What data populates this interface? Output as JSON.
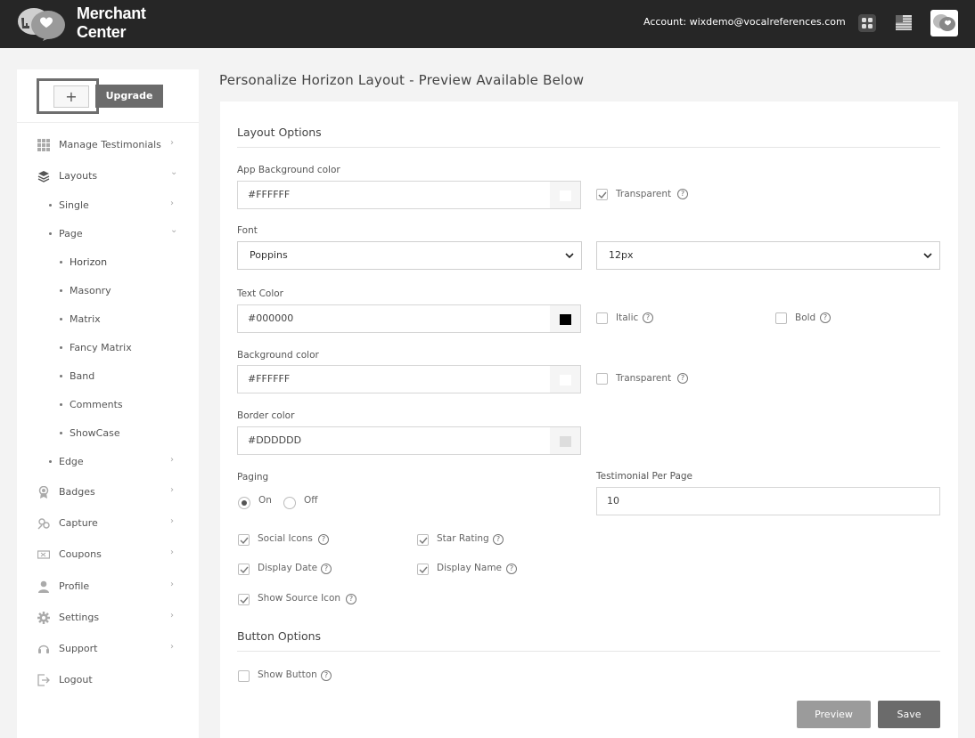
{
  "header": {
    "brand_line1": "Merchant",
    "brand_line2": "Center",
    "account": "Account: wixdemo@vocalreferences.com"
  },
  "sidebar": {
    "plus_label": "+",
    "upgrade_label": "Upgrade",
    "items": [
      {
        "label": "Manage Testimonials",
        "icon": "grid-icon"
      },
      {
        "label": "Layouts",
        "icon": "layers-icon"
      },
      {
        "label": "Single"
      },
      {
        "label": "Page"
      },
      {
        "label": "Horizon"
      },
      {
        "label": "Masonry"
      },
      {
        "label": "Matrix"
      },
      {
        "label": "Fancy Matrix"
      },
      {
        "label": "Band"
      },
      {
        "label": "Comments"
      },
      {
        "label": "ShowCase"
      },
      {
        "label": "Edge"
      },
      {
        "label": "Badges",
        "icon": "badge-icon"
      },
      {
        "label": "Capture",
        "icon": "capture-icon"
      },
      {
        "label": "Coupons",
        "icon": "coupon-icon"
      },
      {
        "label": "Profile",
        "icon": "user-icon"
      },
      {
        "label": "Settings",
        "icon": "gear-icon"
      },
      {
        "label": "Support",
        "icon": "support-icon"
      },
      {
        "label": "Logout",
        "icon": "logout-icon"
      }
    ]
  },
  "main": {
    "title": "Personalize Horizon Layout - Preview Available Below",
    "layout_options": "Layout Options",
    "app_bg_label": "App Background color",
    "app_bg_value": "#FFFFFF",
    "transparent_label": "Transparent",
    "font_label": "Font",
    "font_value": "Poppins",
    "font_size_value": "12px",
    "text_color_label": "Text Color",
    "text_color_value": "#000000",
    "italic_label": "Italic",
    "bold_label": "Bold",
    "bg_color_label": "Background color",
    "bg_color_value": "#FFFFFF",
    "border_color_label": "Border color",
    "border_color_value": "#DDDDDD",
    "paging_label": "Paging",
    "paging_on": "On",
    "paging_off": "Off",
    "per_page_label": "Testimonial Per Page",
    "per_page_value": "10",
    "social_icons": "Social Icons",
    "star_rating": "Star Rating",
    "display_date": "Display Date",
    "display_name": "Display Name",
    "show_source_icon": "Show Source Icon",
    "button_options": "Button Options",
    "show_button": "Show Button",
    "preview_label": "Preview",
    "save_label": "Save",
    "help_glyph": "?"
  },
  "colors": {
    "topbar": "#262626",
    "text_swatch": "#000000",
    "border_swatch": "#DDDDDD",
    "button_dark": "#6b6b6b"
  }
}
